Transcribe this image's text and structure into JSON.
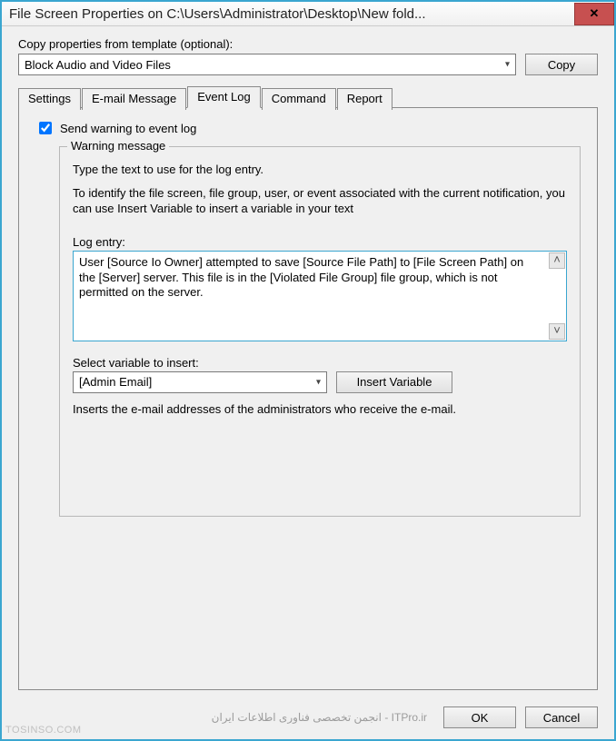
{
  "window": {
    "title": "File Screen Properties on C:\\Users\\Administrator\\Desktop\\New fold..."
  },
  "template": {
    "label": "Copy properties from template (optional):",
    "selected": "Block Audio and Video Files",
    "copy_label": "Copy"
  },
  "tabs": {
    "settings": "Settings",
    "email": "E-mail Message",
    "eventlog": "Event Log",
    "command": "Command",
    "report": "Report"
  },
  "eventlog": {
    "checkbox_label": "Send warning to event log",
    "checked": true,
    "groupbox_title": "Warning message",
    "desc1": "Type the text to use for the log entry.",
    "desc2": "To identify the file screen, file group, user, or event associated with the current notification, you can use Insert Variable to insert a variable in your text",
    "log_entry_label": "Log entry:",
    "log_entry_text": "User [Source Io Owner] attempted to save [Source File Path] to [File Screen Path] on the [Server] server. This file is in the [Violated File Group] file group, which is not permitted on the server.",
    "var_label": "Select variable to insert:",
    "var_selected": "[Admin Email]",
    "insert_label": "Insert Variable",
    "var_desc": "Inserts the e-mail addresses of the administrators who receive the e-mail."
  },
  "footer": {
    "ok": "OK",
    "cancel": "Cancel",
    "watermark": "ITPro.ir - انجمن تخصصی فناوری اطلاعات ایران",
    "corner": "TOSINSO.COM"
  }
}
